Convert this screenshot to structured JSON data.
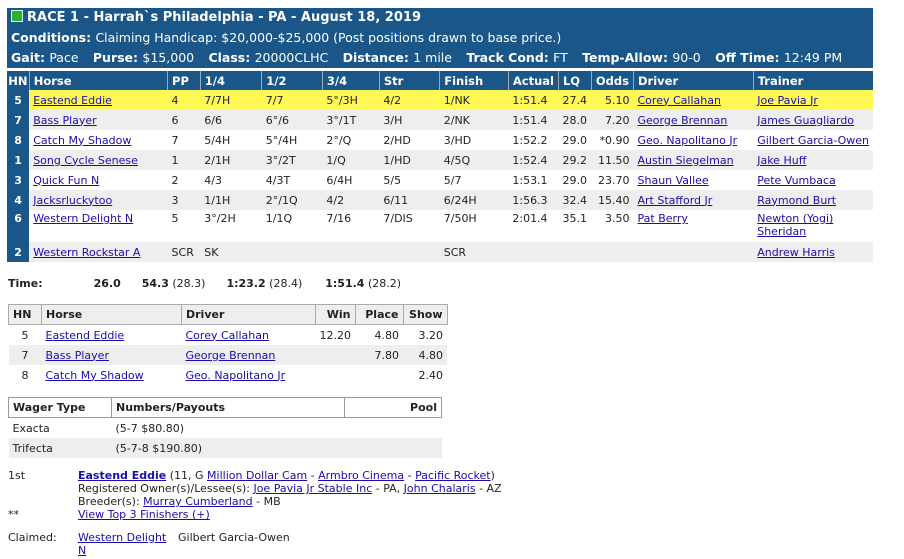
{
  "header": {
    "title": "RACE 1 - Harrah`s Philadelphia - PA - August 18, 2019",
    "conditions_label": "Conditions:",
    "conditions": "Claiming Handicap: $20,000-$25,000 (Post positions drawn to base price.)",
    "gait_label": "Gait:",
    "gait": "Pace",
    "purse_label": "Purse:",
    "purse": "$15,000",
    "class_label": "Class:",
    "class": "20000CLHC",
    "distance_label": "Distance:",
    "distance": "1 mile",
    "track_label": "Track Cond:",
    "track": "FT",
    "temp_label": "Temp-Allow:",
    "temp": "90-0",
    "off_label": "Off Time:",
    "off": "12:49 PM",
    "status_color": "#2fb12f",
    "bar_color": "#1a5687"
  },
  "results": {
    "columns": [
      "HN",
      "Horse",
      "PP",
      "1/4",
      "1/2",
      "3/4",
      "Str",
      "Finish",
      "Actual",
      "LQ",
      "Odds",
      "Driver",
      "Trainer"
    ],
    "rows": [
      {
        "hn": "5",
        "horse": "Eastend Eddie",
        "pp": "4",
        "q1": "7/7H",
        "q2": "7/7",
        "q3": "5°/3H",
        "str": "4/2",
        "fin": "1/NK",
        "actual": "1:51.4",
        "lq": "27.4",
        "odds": "5.10",
        "driver": "Corey Callahan",
        "trainer": "Joe Pavia Jr"
      },
      {
        "hn": "7",
        "horse": "Bass Player",
        "pp": "6",
        "q1": "6/6",
        "q2": "6°/6",
        "q3": "3°/1T",
        "str": "3/H",
        "fin": "2/NK",
        "actual": "1:51.4",
        "lq": "28.0",
        "odds": "7.20",
        "driver": "George Brennan",
        "trainer": "James Guagliardo"
      },
      {
        "hn": "8",
        "horse": "Catch My Shadow",
        "pp": "7",
        "q1": "5/4H",
        "q2": "5°/4H",
        "q3": "2°/Q",
        "str": "2/HD",
        "fin": "3/HD",
        "actual": "1:52.2",
        "lq": "29.0",
        "odds": "*0.90",
        "driver": "Geo. Napolitano Jr",
        "trainer": "Gilbert Garcia-Owen"
      },
      {
        "hn": "1",
        "horse": "Song Cycle Senese",
        "pp": "1",
        "q1": "2/1H",
        "q2": "3°/2T",
        "q3": "1/Q",
        "str": "1/HD",
        "fin": "4/5Q",
        "actual": "1:52.4",
        "lq": "29.2",
        "odds": "11.50",
        "driver": "Austin Siegelman",
        "trainer": "Jake Huff"
      },
      {
        "hn": "3",
        "horse": "Quick Fun N",
        "pp": "2",
        "q1": "4/3",
        "q2": "4/3T",
        "q3": "6/4H",
        "str": "5/5",
        "fin": "5/7",
        "actual": "1:53.1",
        "lq": "29.0",
        "odds": "23.70",
        "driver": "Shaun Vallee",
        "trainer": "Pete Vumbaca"
      },
      {
        "hn": "4",
        "horse": "Jacksrluckytoo",
        "pp": "3",
        "q1": "1/1H",
        "q2": "2°/1Q",
        "q3": "4/2",
        "str": "6/11",
        "fin": "6/24H",
        "actual": "1:56.3",
        "lq": "32.4",
        "odds": "15.40",
        "driver": "Art Stafford Jr",
        "trainer": "Raymond Burt"
      },
      {
        "hn": "6",
        "horse": "Western Delight N",
        "pp": "5",
        "q1": "3°/2H",
        "q2": "1/1Q",
        "q3": "7/16",
        "str": "7/DIS",
        "fin": "7/50H",
        "actual": "2:01.4",
        "lq": "35.1",
        "odds": "3.50",
        "driver": "Pat Berry",
        "trainer": "Newton (Yogi) Sheridan"
      },
      {
        "hn": "2",
        "horse": "Western Rockstar A",
        "pp": "SCR",
        "q1": "SK",
        "q2": "",
        "q3": "",
        "str": "",
        "fin": "SCR",
        "actual": "",
        "lq": "",
        "odds": "",
        "driver": "",
        "trainer": "Andrew Harris"
      }
    ],
    "highlight_color": "#fff855"
  },
  "times": {
    "label": "Time:",
    "q1": "26.0",
    "q2": "54.3",
    "q2s": "(28.3)",
    "q3": "1:23.2",
    "q3s": "(28.4)",
    "fin": "1:51.4",
    "fins": "(28.2)"
  },
  "payouts": {
    "columns": [
      "HN",
      "Horse",
      "Driver",
      "Win",
      "Place",
      "Show"
    ],
    "rows": [
      {
        "hn": "5",
        "horse": "Eastend Eddie",
        "driver": "Corey Callahan",
        "win": "12.20",
        "place": "4.80",
        "show": "3.20"
      },
      {
        "hn": "7",
        "horse": "Bass Player",
        "driver": "George Brennan",
        "win": "",
        "place": "7.80",
        "show": "4.80"
      },
      {
        "hn": "8",
        "horse": "Catch My Shadow",
        "driver": "Geo. Napolitano Jr",
        "win": "",
        "place": "",
        "show": "2.40"
      }
    ]
  },
  "wagers": {
    "columns": [
      "Wager Type",
      "Numbers/Payouts",
      "Pool"
    ],
    "rows": [
      {
        "type": "Exacta",
        "payout": "(5-7 $80.80)",
        "pool": ""
      },
      {
        "type": "Trifecta",
        "payout": "(5-7-8 $190.80)",
        "pool": ""
      }
    ]
  },
  "footer": {
    "first_label": "1st",
    "winner": "Eastend Eddie",
    "winner_info": "(11, G",
    "sire": "Million Dollar Cam",
    "dam": "Armbro Cinema",
    "damsire": "Pacific Rocket",
    "close_paren": ")",
    "owner_label": "Registered Owner(s)/Lessee(s):",
    "owner1": "Joe Pavia Jr Stable Inc",
    "owner1_loc": "- PA,",
    "owner2": "John Chalaris",
    "owner2_loc": "- AZ",
    "breeder_label": "Breeder(s):",
    "breeder": "Murray Cumberland",
    "breeder_loc": "- MB",
    "stars": "**",
    "view_top": "View Top 3 Finishers (+)",
    "claimed_label": "Claimed:",
    "claimed_horse_1": "Western Delight",
    "claimed_horse_2": "N",
    "claimed_by": "Gilbert Garcia-Owen"
  }
}
